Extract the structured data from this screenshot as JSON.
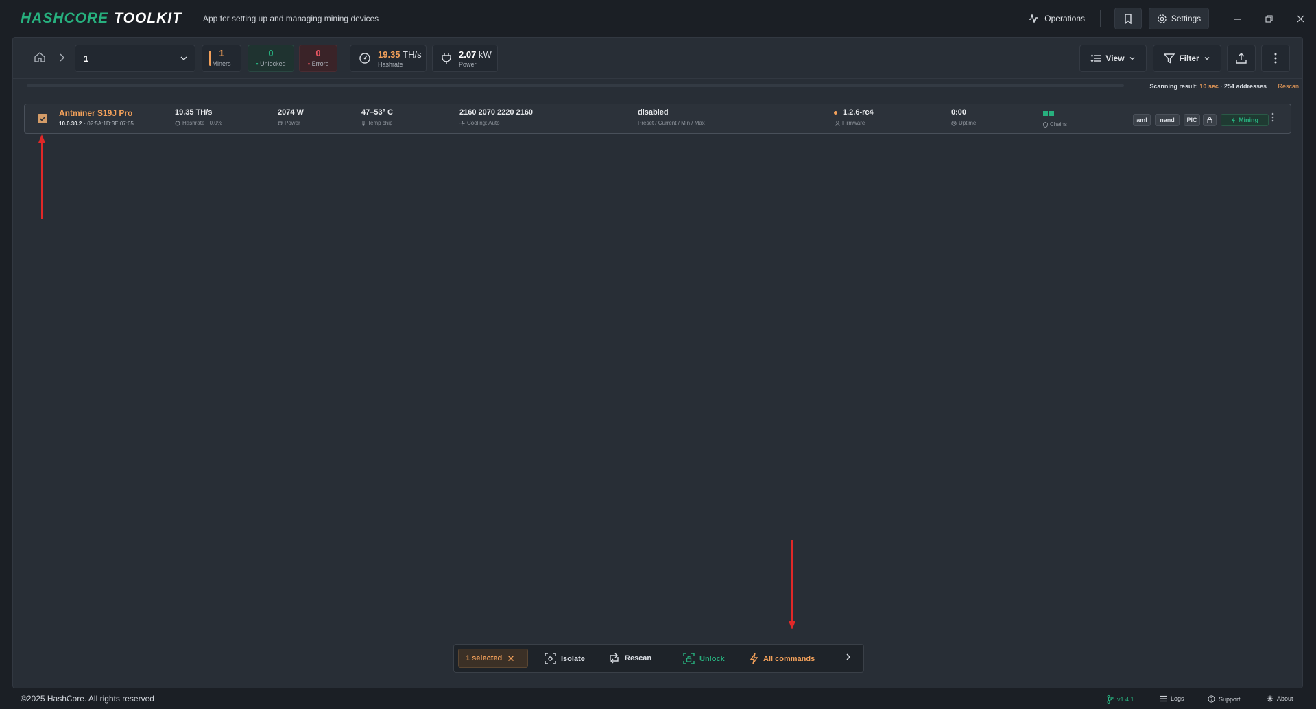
{
  "app": {
    "brand_a": "HASHCORE",
    "brand_b": "TOOLKIT",
    "subtitle": "App for setting up and managing mining devices",
    "operations_label": "Operations",
    "settings_label": "Settings"
  },
  "toolbar": {
    "group_value": "1",
    "stats": {
      "miners": {
        "value": "1",
        "label": "Miners"
      },
      "unlocked": {
        "value": "0",
        "label": "Unlocked"
      },
      "errors": {
        "value": "0",
        "label": "Errors"
      },
      "hashrate": {
        "value": "19.35",
        "unit": "TH/s",
        "label": "Hashrate"
      },
      "power": {
        "value": "2.07",
        "unit": "kW",
        "label": "Power"
      }
    },
    "view_label": "View",
    "filter_label": "Filter"
  },
  "scan": {
    "prefix": "Scanning result:",
    "duration": "10 sec",
    "sep": "·",
    "addresses": "254 addresses",
    "rescan_label": "Rescan"
  },
  "miner": {
    "name": "Antminer S19J Pro",
    "ip": "10.0.30.2",
    "mac": "02:5A:1D:3E:07:65",
    "hashrate": "19.35 TH/s",
    "hashrate_sub": "Hashrate · 0.0%",
    "power": "2074 W",
    "power_sub": "Power",
    "temp": "47–53° C",
    "temp_sub": "Temp chip",
    "fans": "2160 2070 2220 2160",
    "fans_sub": "Cooling: Auto",
    "preset": "disabled",
    "preset_sub": "Preset / Current / Min / Max",
    "firmware": "1.2.6-rc4",
    "firmware_sub": "Firmware",
    "uptime": "0:00",
    "uptime_sub": "Uptime",
    "chains_sub": "Chains",
    "tags": [
      "aml",
      "nand",
      "PIC"
    ],
    "status": "Mining"
  },
  "actionbar": {
    "selected": "1 selected",
    "isolate": "Isolate",
    "rescan": "Rescan",
    "unlock": "Unlock",
    "all_commands": "All commands"
  },
  "footer": {
    "copyright": "©2025 HashCore. All rights reserved",
    "version": "v1.4.1",
    "logs": "Logs",
    "support": "Support",
    "about": "About"
  },
  "colors": {
    "accent_orange": "#f2a05a",
    "accent_green": "#27b07e",
    "error_red": "#e85662",
    "annotation_red": "#e02828"
  }
}
